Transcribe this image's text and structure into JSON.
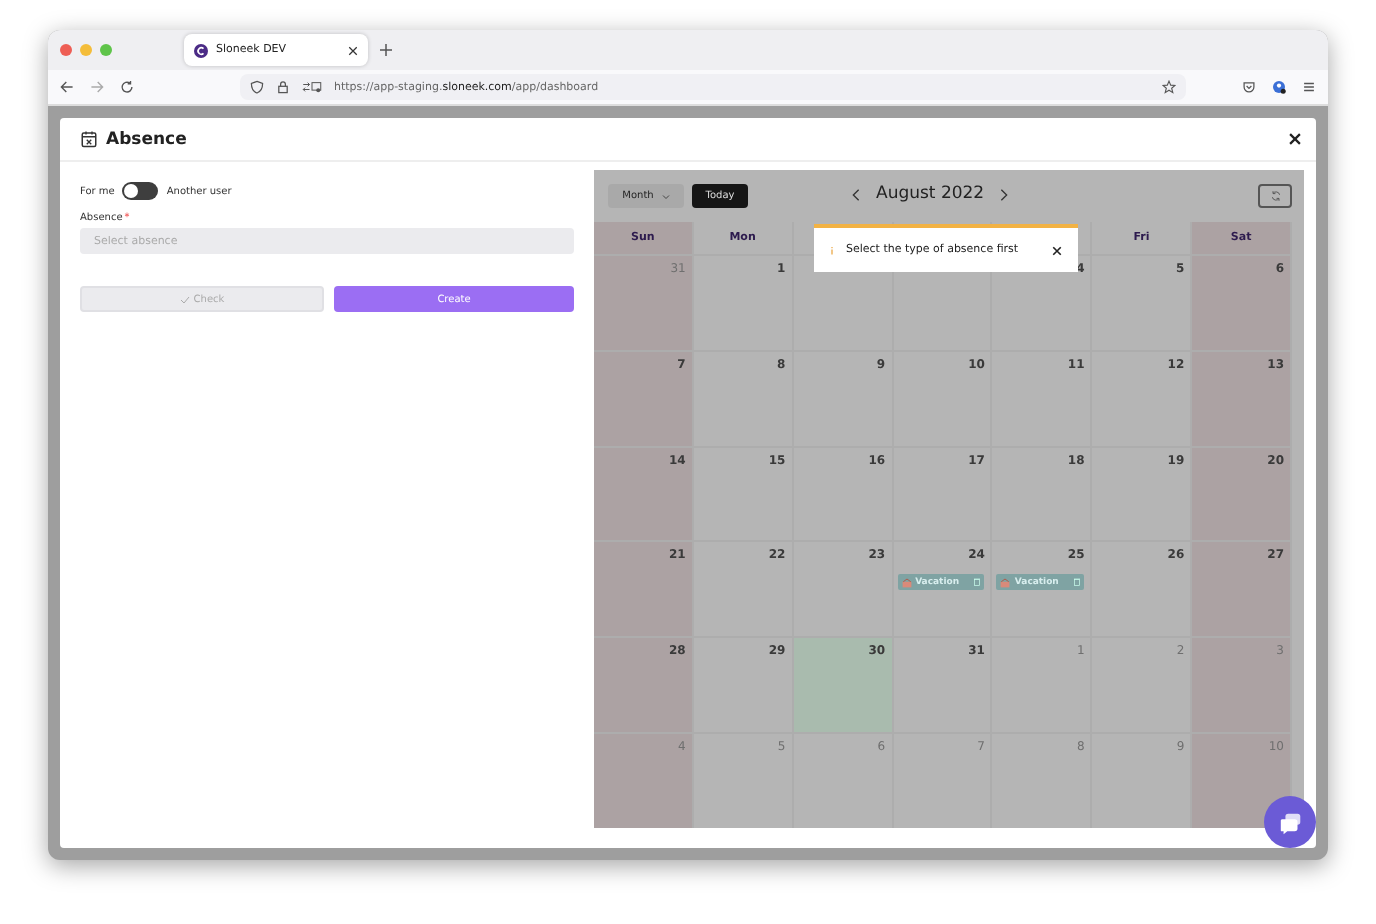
{
  "browser": {
    "tab_title": "Sloneek DEV",
    "url": "https://app-staging.**sloneek.com**/app/dashboard"
  },
  "dialog": {
    "title": "Absence",
    "toggle": {
      "left_label": "For me",
      "right_label": "Another user",
      "on": false
    },
    "field": {
      "label": "Absence",
      "required_mark": "*",
      "placeholder": "Select absence"
    },
    "buttons": [
      {
        "label": "Check",
        "kind": "check",
        "disabled": true
      },
      {
        "label": "Create",
        "kind": "primary",
        "disabled": false
      }
    ]
  },
  "calendar": {
    "view": "Month",
    "today_button": "Today",
    "title": "August 2022",
    "weekdays": [
      {
        "label": "Sun",
        "weekend": true
      },
      {
        "label": "Mon",
        "weekend": false
      },
      {
        "weekend": false
      },
      {
        "weekend": false
      },
      {
        "weekend": false
      },
      {
        "label": "Fri",
        "weekend": false
      },
      {
        "label": "Sat",
        "weekend": true
      }
    ],
    "weeks": [
      [
        {
          "day": "31",
          "outside": true,
          "today": false
        },
        {
          "day": "1",
          "outside": false,
          "today": false
        },
        {
          "today": false
        },
        {
          "today": false
        },
        {
          "day": "4",
          "outside": false,
          "today": false
        },
        {
          "day": "5",
          "outside": false,
          "today": false
        },
        {
          "day": "6",
          "outside": false,
          "today": false
        }
      ],
      [
        {
          "day": "7",
          "outside": false,
          "today": false
        },
        {
          "day": "8",
          "outside": false,
          "today": false
        },
        {
          "day": "9",
          "outside": false,
          "today": false
        },
        {
          "day": "10",
          "outside": false,
          "today": false
        },
        {
          "day": "11",
          "outside": false,
          "today": false
        },
        {
          "day": "12",
          "outside": false,
          "today": false
        },
        {
          "day": "13",
          "outside": false,
          "today": false
        }
      ],
      [
        {
          "day": "14",
          "outside": false,
          "today": false
        },
        {
          "day": "15",
          "outside": false,
          "today": false
        },
        {
          "day": "16",
          "outside": false,
          "today": false
        },
        {
          "day": "17",
          "outside": false,
          "today": false
        },
        {
          "day": "18",
          "outside": false,
          "today": false
        },
        {
          "day": "19",
          "outside": false,
          "today": false
        },
        {
          "day": "20",
          "outside": false,
          "today": false
        }
      ],
      [
        {
          "day": "21",
          "outside": false,
          "today": false
        },
        {
          "day": "22",
          "outside": false,
          "today": false
        },
        {
          "day": "23",
          "outside": false,
          "today": false
        },
        {
          "day": "24",
          "outside": false,
          "today": false,
          "events": [
            "Vacation"
          ]
        },
        {
          "day": "25",
          "outside": false,
          "today": false,
          "events": [
            "Vacation"
          ]
        },
        {
          "day": "26",
          "outside": false,
          "today": false
        },
        {
          "day": "27",
          "outside": false,
          "today": false
        }
      ],
      [
        {
          "day": "28",
          "outside": false,
          "today": false
        },
        {
          "day": "29",
          "outside": false,
          "today": false
        },
        {
          "day": "30",
          "outside": false,
          "today": true
        },
        {
          "day": "31",
          "outside": false,
          "today": false
        },
        {
          "day": "1",
          "outside": true,
          "today": false
        },
        {
          "day": "2",
          "outside": true,
          "today": false
        },
        {
          "day": "3",
          "outside": true,
          "today": false
        }
      ],
      [
        {
          "day": "4",
          "outside": true,
          "today": false
        },
        {
          "day": "5",
          "outside": true,
          "today": false
        },
        {
          "day": "6",
          "outside": true,
          "today": false
        },
        {
          "day": "7",
          "outside": true,
          "today": false
        },
        {
          "day": "8",
          "outside": true,
          "today": false
        },
        {
          "day": "9",
          "outside": true,
          "today": false
        },
        {
          "day": "10",
          "outside": true,
          "today": false
        }
      ]
    ],
    "toast": "Select the type of absence first"
  }
}
